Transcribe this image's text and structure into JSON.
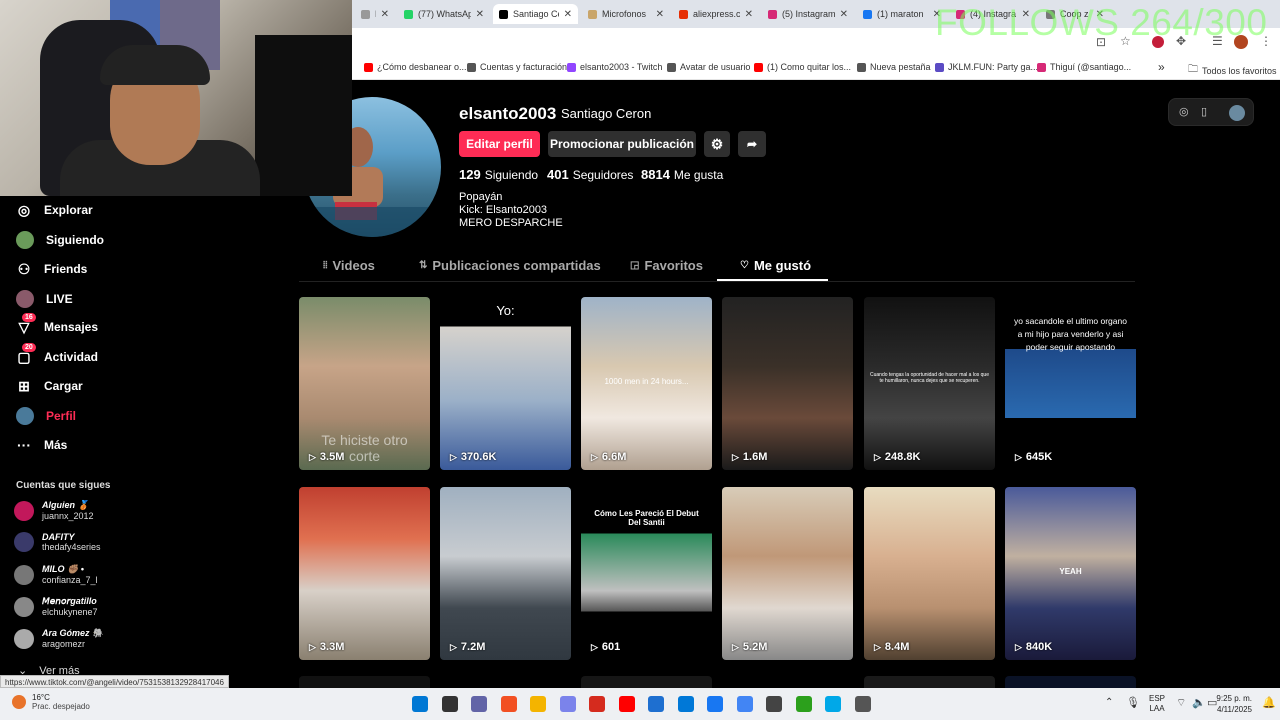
{
  "overlay": {
    "follows_counter": "FOLLOWS 264/300"
  },
  "browser": {
    "tabs": [
      {
        "label": "D",
        "color": "#999"
      },
      {
        "label": "(77) WhatsAp",
        "color": "#25d366"
      },
      {
        "label": "Santiago Ce",
        "color": "#000"
      },
      {
        "label": "Microfonos",
        "color": "#c9a56a"
      },
      {
        "label": "aliexpress.co",
        "color": "#e62e04"
      },
      {
        "label": "(5) Instagram",
        "color": "#d62976"
      },
      {
        "label": "(1) maraton",
        "color": "#1877f2"
      },
      {
        "label": "(4) Instagra",
        "color": "#d62976"
      },
      {
        "label": "Coop z G",
        "color": "#777"
      }
    ],
    "bookmarks": [
      {
        "label": "¿Cómo desbanear o...",
        "color": "#ff0000"
      },
      {
        "label": "Cuentas y facturación",
        "color": "#555"
      },
      {
        "label": "elsanto2003 - Twitch",
        "color": "#9146ff"
      },
      {
        "label": "Avatar de usuario",
        "color": "#555"
      },
      {
        "label": "(1) Como quitar los...",
        "color": "#ff0000"
      },
      {
        "label": "Nueva pestaña",
        "color": "#555"
      },
      {
        "label": "JKLM.FUN: Party ga...",
        "color": "#5b4bc4"
      },
      {
        "label": "Thiguí (@santiago...",
        "color": "#d62976"
      }
    ],
    "bookmarks_more": "»",
    "all_favorites": "Todos los favoritos",
    "status_url": "https://www.tiktok.com/@angeli/video/7531538132928417046"
  },
  "sidebar": {
    "items": [
      {
        "label": "Explorar",
        "icon": "compass-icon",
        "glyph": "◎"
      },
      {
        "label": "Siguiendo",
        "icon": "following-avatar-icon",
        "glyph": ""
      },
      {
        "label": "Friends",
        "icon": "friends-icon",
        "glyph": "⚇"
      },
      {
        "label": "LIVE",
        "icon": "live-avatar-icon",
        "glyph": ""
      },
      {
        "label": "Mensajes",
        "icon": "messages-icon",
        "glyph": "▽",
        "badge": "16"
      },
      {
        "label": "Actividad",
        "icon": "activity-icon",
        "glyph": "▢",
        "badge": "20"
      },
      {
        "label": "Cargar",
        "icon": "upload-icon",
        "glyph": "⊞"
      },
      {
        "label": "Perfil",
        "icon": "profile-avatar-icon",
        "glyph": ""
      },
      {
        "label": "Más",
        "icon": "more-icon",
        "glyph": "···"
      }
    ],
    "following_title": "Cuentas que sigues",
    "following": [
      {
        "name": "Alguien 🥉",
        "handle": "juannx_2012",
        "color": "#c2185b"
      },
      {
        "name": "DAFITY",
        "handle": "thedafy4series",
        "color": "#3a3a6a"
      },
      {
        "name": "MILO ✊🏽 •",
        "handle": "confianza_7_l",
        "color": "#777"
      },
      {
        "name": "𝘔𝘦𝘯𝘰𝘳gatillo",
        "handle": "elchukynene7",
        "color": "#888"
      },
      {
        "name": "Ara Gómez 🐘",
        "handle": "aragomezr",
        "color": "#aaa"
      }
    ],
    "see_more": "Ver más"
  },
  "profile": {
    "username": "elsanto2003",
    "display_name": "Santiago Ceron",
    "edit_button": "Editar perfil",
    "promote_button": "Promocionar publicación",
    "following_count": "129",
    "following_label": "Siguiendo",
    "followers_count": "401",
    "followers_label": "Seguidores",
    "likes_count": "8814",
    "likes_label": "Me gusta",
    "bio_line1": "Popayán",
    "bio_line2": "Kick: Elsanto2003",
    "bio_line3": "MERO DESPARCHE"
  },
  "profile_tabs": [
    {
      "label": "Videos",
      "glyph": "⦙⦙"
    },
    {
      "label": "Publicaciones compartidas",
      "glyph": "⇅"
    },
    {
      "label": "Favoritos",
      "glyph": "◲"
    },
    {
      "label": "Me gustó",
      "glyph": "♡"
    }
  ],
  "videos": [
    {
      "views": "3.5M",
      "caption": "Te hiciste otro corte",
      "bg": "linear-gradient(180deg,#7a8c6a,#c7a488 40%,#a98a70 70%,#5a6a50)"
    },
    {
      "views": "370.6K",
      "caption": "Yo:",
      "bg": "linear-gradient(180deg,#000 0%,#000 17%,#d6d2cc 17%,#9bb0c8 60%,#3a5a9a 100%)"
    },
    {
      "views": "6.6M",
      "caption": "1000 men in 24 hours...",
      "bg": "linear-gradient(180deg,#9fb3c8,#d8c8b0 40%,#f0e8e0 70%,#b0a090)"
    },
    {
      "views": "1.6M",
      "caption": "",
      "bg": "linear-gradient(180deg,#222,#3a3028 40%,#6a4a3a 70%,#1a1a1a)"
    },
    {
      "views": "248.8K",
      "caption": "Cuando tengas la oportunidad de hacer mal a los que te humillaron, nunca dejes que se recuperen.",
      "bg": "linear-gradient(180deg,#111,#2a2a2a 40%,#444 70%,#111)"
    },
    {
      "views": "645K",
      "caption": "yo sacandole el ultimo organo a mi hijo para venderlo y asi poder seguir apostando",
      "bg": "linear-gradient(180deg,#000 0%,#000 30%,#1e4a8a 30%,#2a6ab0 70%,#000 70%)"
    },
    {
      "views": "3.3M",
      "caption": "",
      "bg": "linear-gradient(180deg,#c04030,#e07050 30%,#d8d0c8 60%,#8a8070)"
    },
    {
      "views": "7.2M",
      "caption": "",
      "bg": "linear-gradient(180deg,#a0b0c0,#c8ccd0 40%,#404850 70%,#303840)"
    },
    {
      "views": "601",
      "caption": "Cómo Les Pareció El Debut Del Santii",
      "bg": "linear-gradient(180deg,#000 0%,#000 27%,#2a8a5a 27%,#c0c0c0 60%,#555 72%,#000 72%)"
    },
    {
      "views": "5.2M",
      "caption": "",
      "bg": "linear-gradient(180deg,#d8ccb8,#c09878 40%,#e0d8d0 70%,#888)"
    },
    {
      "views": "8.4M",
      "caption": "",
      "bg": "linear-gradient(180deg,#e8dcc0,#d8b090 40%,#b89070 70%,#504030)"
    },
    {
      "views": "840K",
      "caption": "YEAH",
      "bg": "linear-gradient(180deg,#4a5a9a,#c0b0a0 40%,#303a6a 70%,#1a1a3a)"
    }
  ],
  "taskbar": {
    "weather_temp": "16°C",
    "weather_desc": "Prac. despejado",
    "lang1": "ESP",
    "lang2": "LAA",
    "time": "9:25 p. m.",
    "date": "4/11/2025"
  }
}
